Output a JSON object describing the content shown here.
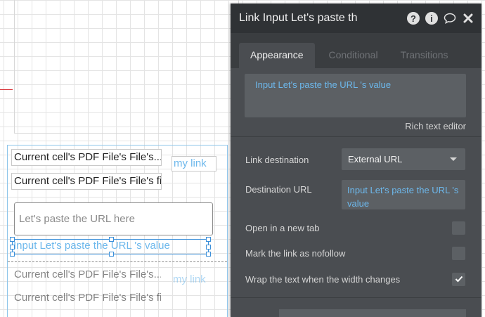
{
  "canvas": {
    "rows": [
      {
        "text": "Current cell's PDF File's File's..."
      },
      {
        "text": "Current cell's PDF File's File's fi..."
      }
    ],
    "link_text": "my link",
    "input_placeholder": "Let's paste the URL here",
    "selected_link_text": "Input Let's paste the URL 's value",
    "faded_rows": [
      {
        "text": "Current cell's PDF File's File's..."
      },
      {
        "text": "Current cell's PDF File's File's fi..."
      }
    ],
    "faded_link_text": "my link"
  },
  "panel": {
    "title": "Link Input Let's paste th",
    "icons": [
      "help-icon",
      "info-icon",
      "comment-icon",
      "close-icon"
    ],
    "tabs": [
      {
        "label": "Appearance",
        "active": true
      },
      {
        "label": "Conditional",
        "active": false
      },
      {
        "label": "Transitions",
        "active": false
      }
    ],
    "rich_text_value": "Input Let's paste the URL 's value",
    "rich_text_caption": "Rich text editor",
    "link_destination_label": "Link destination",
    "link_destination_value": "External URL",
    "destination_url_label": "Destination URL",
    "destination_url_value": "Input Let's paste the URL 's value",
    "open_new_tab_label": "Open in a new tab",
    "open_new_tab_checked": false,
    "nofollow_label": "Mark the link as nofollow",
    "nofollow_checked": false,
    "wrap_text_label": "Wrap the text when the width changes",
    "wrap_text_checked": true
  },
  "colors": {
    "panel_bg": "#4a4d51",
    "header_bg": "#2f3235",
    "link_blue": "#6db8ec",
    "selection_blue": "#3b8fd9"
  }
}
